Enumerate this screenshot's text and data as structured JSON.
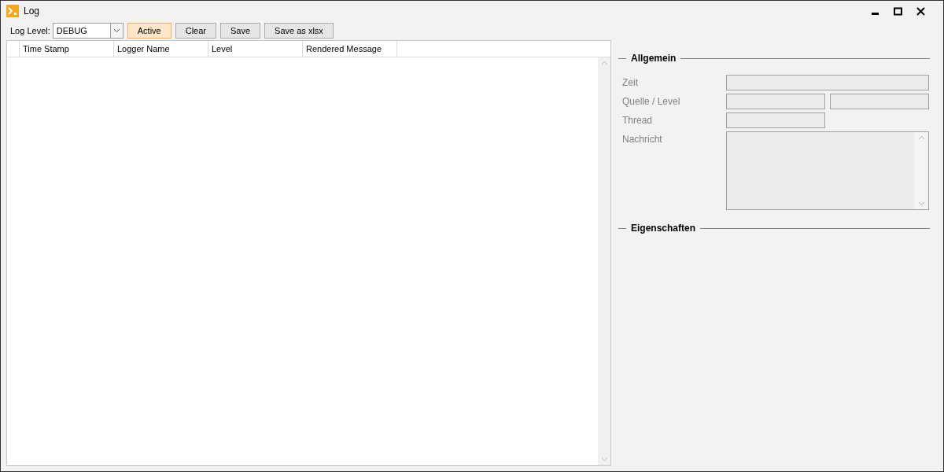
{
  "window": {
    "title": "Log"
  },
  "toolbar": {
    "log_level_label": "Log Level:",
    "log_level": "DEBUG",
    "buttons": [
      {
        "label": "Active",
        "selected": true
      },
      {
        "label": "Clear",
        "selected": false
      },
      {
        "label": "Save",
        "selected": false
      },
      {
        "label": "Save as xlsx",
        "selected": false
      }
    ]
  },
  "table": {
    "columns": [
      "Time Stamp",
      "Logger Name",
      "Level",
      "Rendered Message"
    ]
  },
  "details": {
    "general_title": "Allgemein",
    "fields": [
      {
        "label": "Zeit",
        "kind": "single"
      },
      {
        "label": "Quelle / Level",
        "kind": "pair"
      },
      {
        "label": "Thread",
        "kind": "half"
      },
      {
        "label": "Nachricht",
        "kind": "multiline"
      }
    ],
    "properties_title": "Eigenschaften"
  }
}
